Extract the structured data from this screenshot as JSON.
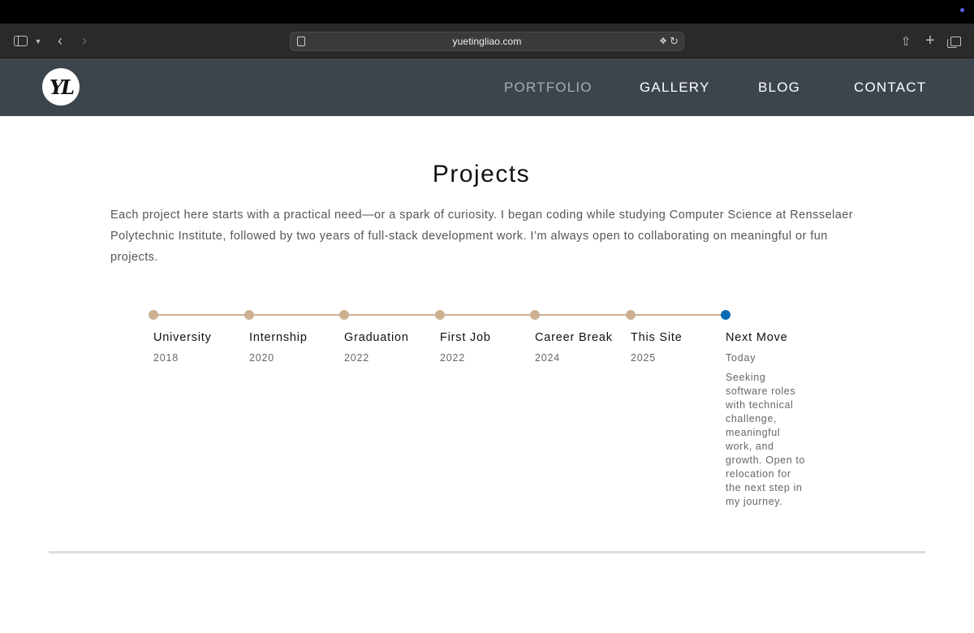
{
  "browser": {
    "url": "yuetingliao.com"
  },
  "site": {
    "logo_text": "YL",
    "nav": [
      {
        "label": "PORTFOLIO"
      },
      {
        "label": "GALLERY"
      },
      {
        "label": "BLOG"
      },
      {
        "label": "CONTACT"
      }
    ]
  },
  "main": {
    "title": "Projects",
    "intro": "Each project here starts with a practical need—or a spark of curiosity. I began coding while studying Computer Science at Rensselaer Polytechnic Institute, followed by two years of full-stack development work. I’m always open to collaborating on meaningful or fun projects."
  },
  "timeline": [
    {
      "label": "University",
      "year": "2018"
    },
    {
      "label": "Internship",
      "year": "2020"
    },
    {
      "label": "Graduation",
      "year": "2022"
    },
    {
      "label": "First Job",
      "year": "2022"
    },
    {
      "label": "Career Break",
      "year": "2024"
    },
    {
      "label": "This Site",
      "year": "2025"
    },
    {
      "label": "Next Move",
      "year": "Today",
      "description": "Seeking software roles with technical challenge, meaningful work, and growth. Open to relocation for the next step in my journey."
    }
  ],
  "colors": {
    "header_bg": "#3d454c",
    "timeline_accent": "#cdb08f",
    "timeline_current": "#0b6bb2"
  }
}
